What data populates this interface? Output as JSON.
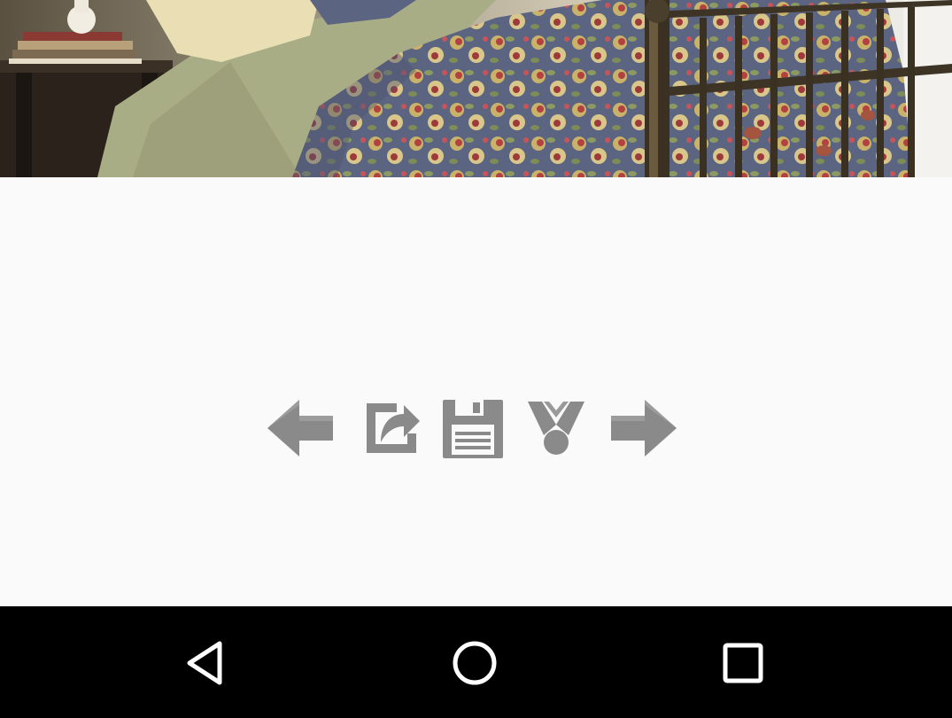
{
  "photo": {
    "description_icon": "bedroom-photo"
  },
  "toolbar": {
    "items": [
      {
        "name": "previous",
        "icon": "arrow-left-icon"
      },
      {
        "name": "share",
        "icon": "share-export-icon"
      },
      {
        "name": "save",
        "icon": "floppy-disk-icon"
      },
      {
        "name": "set-as",
        "icon": "award-ribbon-icon"
      },
      {
        "name": "next",
        "icon": "arrow-right-icon"
      }
    ],
    "icon_color": "#8a8a8a"
  },
  "navbar": {
    "buttons": [
      {
        "name": "back",
        "icon": "triangle-back-icon"
      },
      {
        "name": "home",
        "icon": "circle-home-icon"
      },
      {
        "name": "recents",
        "icon": "square-recents-icon"
      }
    ],
    "background": "#000000",
    "icon_color": "#ffffff"
  }
}
